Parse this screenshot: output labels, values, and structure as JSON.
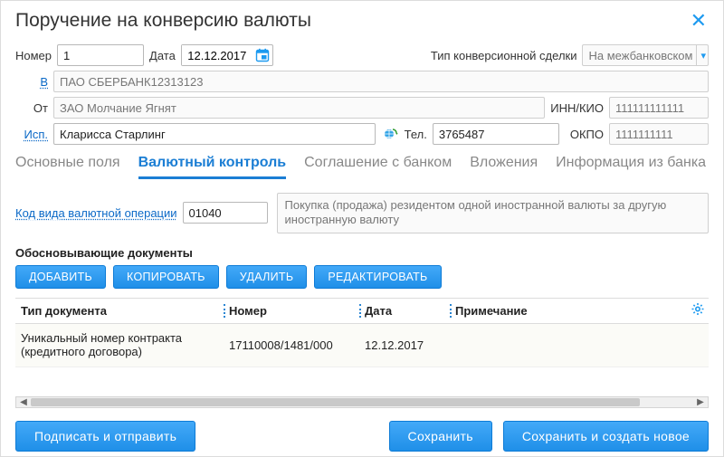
{
  "dialog": {
    "title": "Поручение на конверсию валюты"
  },
  "header": {
    "number_label": "Номер",
    "number_value": "1",
    "date_label": "Дата",
    "date_value": "12.12.2017",
    "deal_type_label": "Тип конверсионной сделки",
    "deal_type_value": "На межбанковском "
  },
  "parties": {
    "to_label": "В",
    "to_value": "ПАО СБЕРБАНК12313123",
    "from_label": "От",
    "from_value": "ЗАО Молчание Ягнят",
    "inn_label": "ИНН/КИО",
    "inn_value": "111111111111",
    "exec_label": "Исп.",
    "exec_value": "Кларисса Старлинг",
    "tel_label": "Тел.",
    "tel_value": "3765487",
    "okpo_label": "ОКПО",
    "okpo_value": "1111111111"
  },
  "tabs": {
    "main": "Основные поля",
    "currency_control": "Валютный контроль",
    "bank_agreement": "Соглашение с банком",
    "attachments": "Вложения",
    "bank_info": "Информация из банка"
  },
  "currency_control": {
    "op_code_label": "Код вида валютной операции",
    "op_code_value": "01040",
    "op_desc": "Покупка (продажа) резидентом одной иностранной валюты за другую иностранную валюту"
  },
  "supporting_docs": {
    "section_title": "Обосновывающие документы",
    "buttons": {
      "add": "ДОБАВИТЬ",
      "copy": "КОПИРОВАТЬ",
      "delete": "УДАЛИТЬ",
      "edit": "РЕДАКТИРОВАТЬ"
    },
    "columns": {
      "doc_type": "Тип документа",
      "number": "Номер",
      "date": "Дата",
      "note": "Примечание"
    },
    "rows": [
      {
        "doc_type": "Уникальный номер контракта (кредитного договора)",
        "number": "17110008/1481/000",
        "date": "12.12.2017",
        "note": ""
      }
    ]
  },
  "footer": {
    "sign_send": "Подписать и отправить",
    "save": "Сохранить",
    "save_new": "Сохранить и создать новое"
  }
}
